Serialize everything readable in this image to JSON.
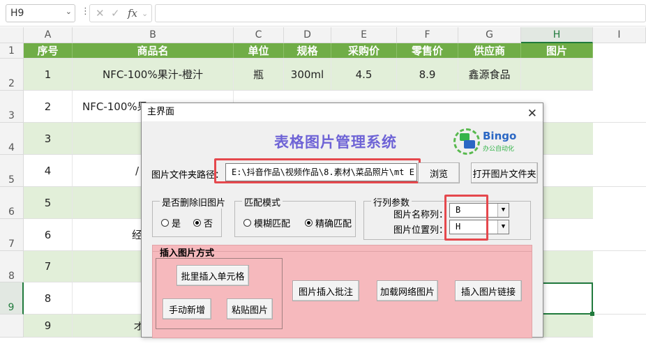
{
  "formula_bar": {
    "name_box": "H9",
    "function_symbol": "fx",
    "formula": ""
  },
  "columns": [
    "A",
    "B",
    "C",
    "D",
    "E",
    "F",
    "G",
    "H",
    "I"
  ],
  "rows": [
    "1",
    "2",
    "3",
    "4",
    "5",
    "6",
    "7",
    "8",
    "9"
  ],
  "header_row": [
    "序号",
    "商品名",
    "单位",
    "规格",
    "采购价",
    "零售价",
    "供应商",
    "图片"
  ],
  "data_rows": [
    [
      "1",
      "NFC-100%果汁-橙汁",
      "瓶",
      "300ml",
      "4.5",
      "8.9",
      "鑫源食品",
      ""
    ],
    [
      "2",
      "NFC-100%果",
      "",
      "",
      "",
      "",
      "",
      ""
    ],
    [
      "3",
      "",
      "",
      "",
      "",
      "",
      "",
      ""
    ],
    [
      "4",
      "/",
      "",
      "",
      "",
      "",
      "",
      ""
    ],
    [
      "5",
      "",
      "",
      "",
      "",
      "",
      "",
      ""
    ],
    [
      "6",
      "经",
      "",
      "",
      "",
      "",
      "",
      ""
    ],
    [
      "7",
      "",
      "",
      "",
      "",
      "",
      "",
      ""
    ],
    [
      "8",
      "",
      "",
      "",
      "",
      "",
      "",
      ""
    ],
    [
      "9",
      "オ",
      "",
      "",
      "",
      "",
      "",
      ""
    ]
  ],
  "dialog": {
    "title": "主界面",
    "app_title": "表格图片管理系统",
    "logo": {
      "name": "Bingo",
      "subtitle": "办公自动化",
      "icon": "bingo-logo-icon"
    },
    "path_label": "图片文件夹路径：",
    "path_value": "E:\\抖音作品\\视频作品\\8.素材\\菜品照片\\mt E",
    "browse_button": "浏览",
    "open_folder_button": "打开图片文件夹",
    "delete_group": {
      "title": "是否删除旧图片",
      "options": [
        "是",
        "否"
      ],
      "selected": "否"
    },
    "match_group": {
      "title": "匹配模式",
      "options": [
        "模糊匹配",
        "精确匹配"
      ],
      "selected": "精确匹配"
    },
    "params_group": {
      "title": "行列参数",
      "name_col_label": "图片名称列：",
      "name_col_value": "B",
      "pos_col_label": "图片位置列：",
      "pos_col_value": "H"
    },
    "insert_section": {
      "title": "插入图片方式",
      "buttons": [
        "批里插入单元格",
        "手动新增",
        "粘贴图片",
        "图片插入批注",
        "加载网络图片",
        "插入图片链接"
      ]
    },
    "highlight_color": "#e5484d"
  }
}
